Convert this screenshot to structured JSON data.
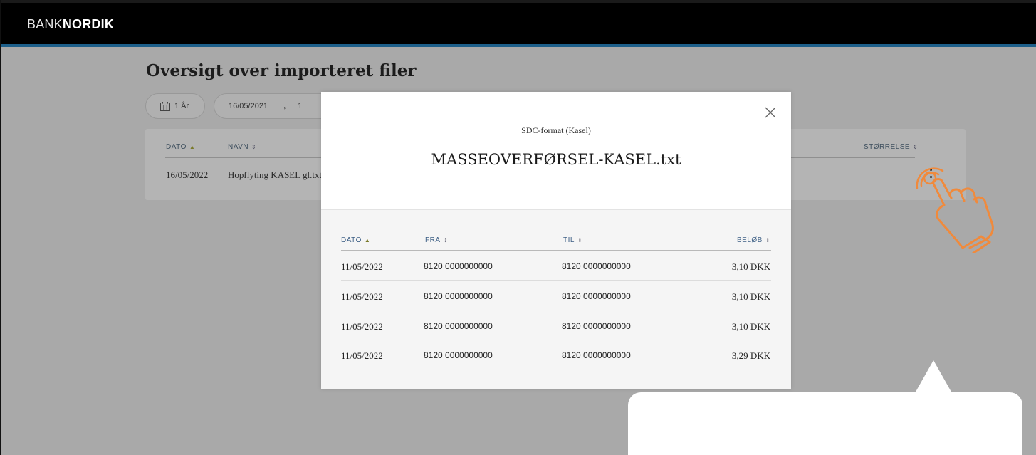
{
  "header": {
    "logo_light": "BANK",
    "logo_bold": "NORDIK"
  },
  "page": {
    "title": "Oversigt over importeret filer"
  },
  "filters": {
    "period_label": "1 År",
    "date_from": "16/05/2021",
    "arrow": "→",
    "date_to_fragment": "1"
  },
  "files_table": {
    "columns": {
      "date": "DATO",
      "name": "NAVN",
      "size": "STØRRELSE"
    },
    "rows": [
      {
        "date": "16/05/2022",
        "name": "Hopflyting KASEL gl.txt"
      }
    ]
  },
  "modal": {
    "subtitle": "SDC-format (Kasel)",
    "title": "MASSEOVERFØRSEL-KASEL.txt",
    "columns": {
      "date": "DATO",
      "from": "FRA",
      "to": "TIL",
      "amount": "BELØB"
    },
    "rows": [
      {
        "date": "11/05/2022",
        "from": "8120 0000000000",
        "to": "8120 0000000000",
        "amount": "3,10 DKK"
      },
      {
        "date": "11/05/2022",
        "from": "8120 0000000000",
        "to": "8120 0000000000",
        "amount": "3,10 DKK"
      },
      {
        "date": "11/05/2022",
        "from": "8120 0000000000",
        "to": "8120 0000000000",
        "amount": "3,10 DKK"
      },
      {
        "date": "11/05/2022",
        "from": "8120 0000000000",
        "to": "8120 0000000000",
        "amount": "3,29 DKK"
      }
    ]
  },
  "icons": {
    "calendar": "calendar-icon",
    "close": "close-icon",
    "more": "more-options-icon",
    "pointer": "hand-pointer-icon",
    "sort": "sort-icon"
  },
  "colors": {
    "topbar": "#000000",
    "accent": "#1d5f8a",
    "overlay": "#a9a9a9",
    "hand": "#f08a3c",
    "header_text": "#3d5f85"
  }
}
